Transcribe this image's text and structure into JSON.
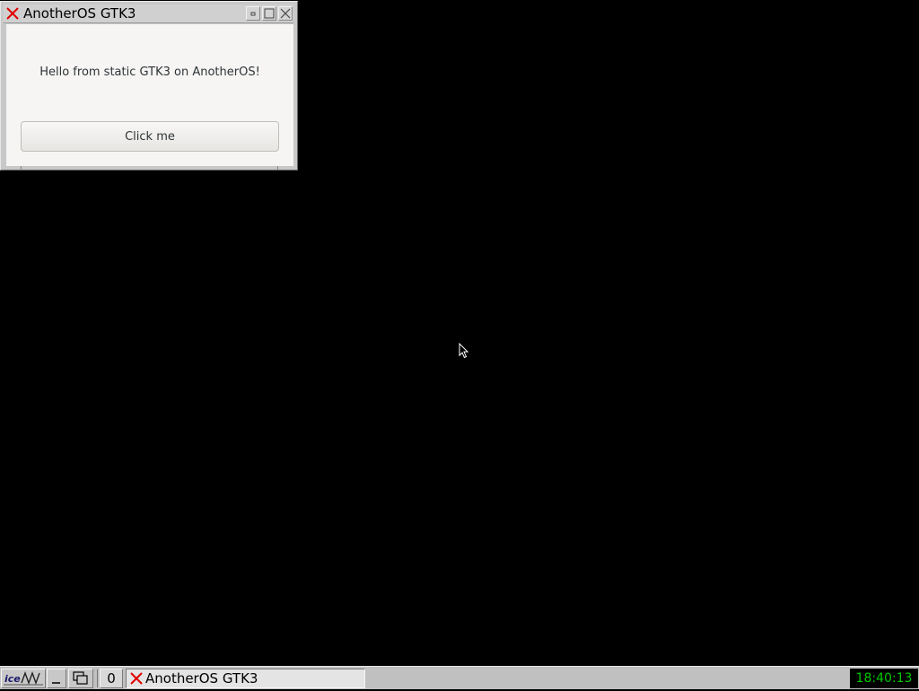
{
  "window": {
    "title": "AnotherOS GTK3",
    "message": "Hello from static GTK3 on AnotherOS!",
    "button_label": "Click me"
  },
  "taskbar": {
    "start_icon": "icewm-logo-icon",
    "workspace": "0",
    "task_label": "AnotherOS GTK3",
    "clock": "18:40:13"
  },
  "colors": {
    "desktop": "#000000",
    "clock_text": "#00c800",
    "app_icon_x": "#e00000"
  }
}
